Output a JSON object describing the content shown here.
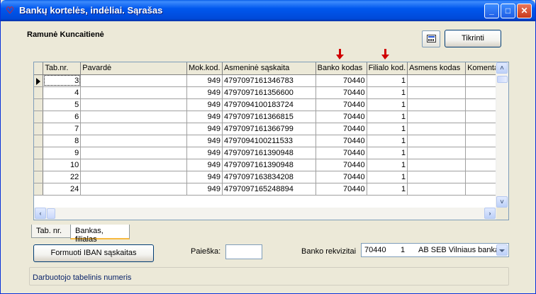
{
  "window": {
    "title": "Bankų kortelės, indėliai. Sąrašas",
    "controls": {
      "minimize": "_",
      "maximize": "□",
      "close": "✕"
    }
  },
  "header": {
    "employee_name": "Ramunė Kuncaitienė",
    "check_button": "Tikrinti"
  },
  "grid": {
    "columns": [
      "Tab.nr.",
      "Pavardė",
      "Mok.kod.",
      "Asmeninė sąskaita",
      "Banko kodas",
      "Filialo kod.",
      "Asmens kodas",
      "Komenta"
    ],
    "rows": [
      [
        "3",
        "",
        "949",
        "4797097161346783",
        "70440",
        "1",
        "",
        ""
      ],
      [
        "4",
        "",
        "949",
        "4797097161356600",
        "70440",
        "1",
        "",
        ""
      ],
      [
        "5",
        "",
        "949",
        "4797094100183724",
        "70440",
        "1",
        "",
        ""
      ],
      [
        "6",
        "",
        "949",
        "4797097161366815",
        "70440",
        "1",
        "",
        ""
      ],
      [
        "7",
        "",
        "949",
        "4797097161366799",
        "70440",
        "1",
        "",
        ""
      ],
      [
        "8",
        "",
        "949",
        "4797094100211533",
        "70440",
        "1",
        "",
        ""
      ],
      [
        "9",
        "",
        "949",
        "4797097161390948",
        "70440",
        "1",
        "",
        ""
      ],
      [
        "10",
        "",
        "949",
        "4797097161390948",
        "70440",
        "1",
        "",
        ""
      ],
      [
        "22",
        "",
        "949",
        "4797097163834208",
        "70440",
        "1",
        "",
        ""
      ],
      [
        "24",
        "",
        "949",
        "4797097165248894",
        "70440",
        "1",
        "",
        ""
      ]
    ]
  },
  "tabs": [
    {
      "label": "Tab. nr.",
      "active": false
    },
    {
      "label": "Bankas, filialas",
      "active": true
    }
  ],
  "footer": {
    "iban_button": "Formuoti IBAN sąskaitas",
    "search_label": "Paieška:",
    "search_value": "",
    "bank_label": "Banko rekvizitai",
    "bank_code": "70440",
    "bank_branch": "1",
    "bank_name": "AB SEB Vilniaus bankas"
  },
  "status": {
    "text": "Darbuotojo tabelinis numeris"
  },
  "colors": {
    "titlebar": "#0058EE",
    "annotation_arrow": "#D00000"
  }
}
